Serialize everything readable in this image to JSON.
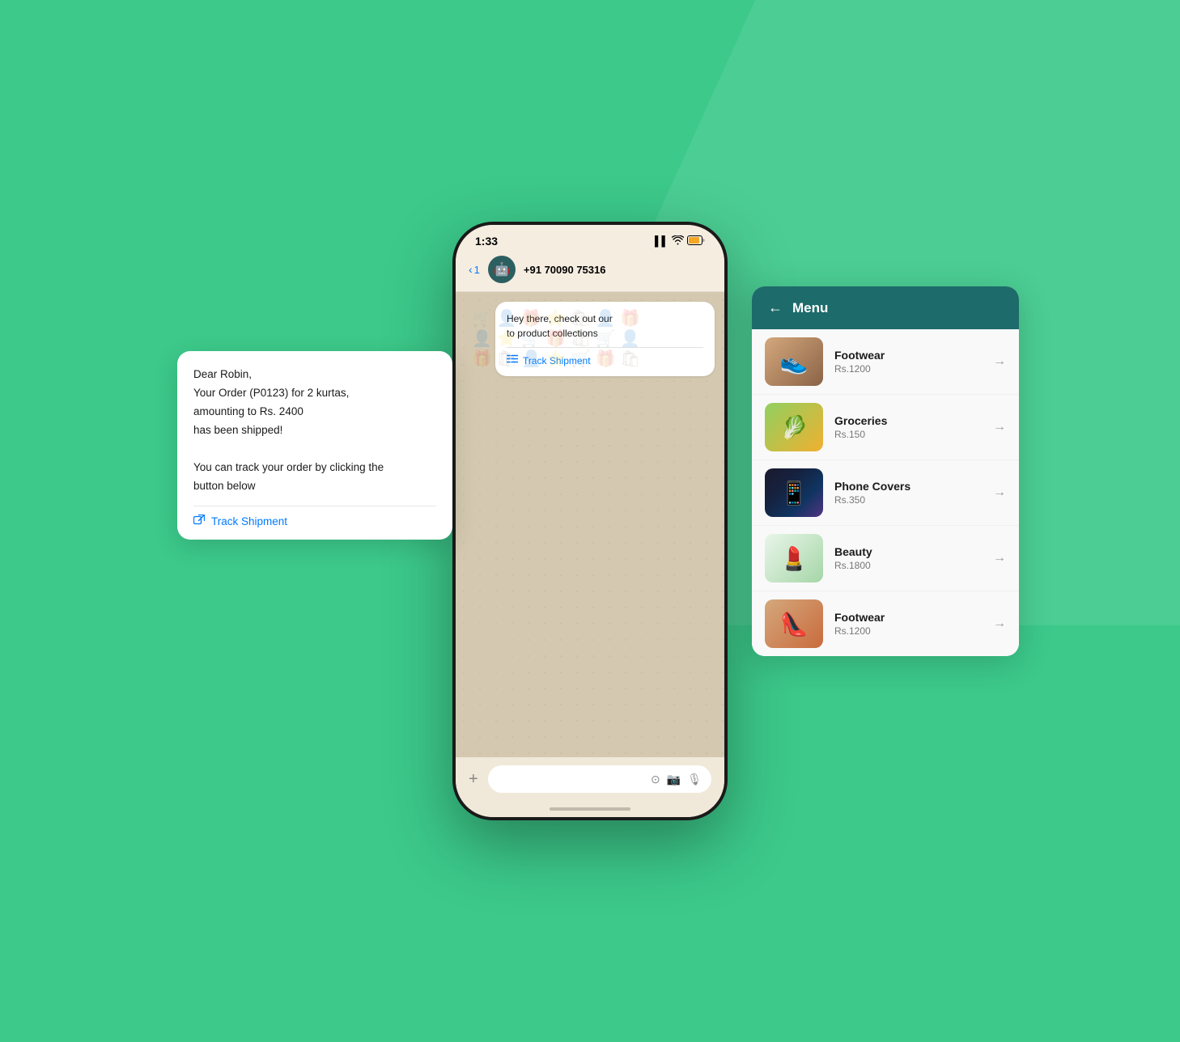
{
  "background": {
    "color": "#3cc98a"
  },
  "status_bar": {
    "time": "1:33",
    "signal": "▌▌",
    "wifi": "WiFi",
    "battery": "🔋"
  },
  "nav": {
    "back_label": "< 1",
    "contact_name": "+91 70090 75316"
  },
  "chat": {
    "bubble1": {
      "text": "Hey there, check out our\nto product collections",
      "link_label": "Track Shipment"
    }
  },
  "bottom_bar": {
    "plus": "+",
    "icons": [
      "⊙",
      "📷",
      "🎙"
    ]
  },
  "left_card": {
    "text": "Dear Robin,\nYour Order (P0123) for 2 kurtas,\namounting to Rs. 2400\nhas been shipped!\n\nYou can track your order by clicking the\nbutton below",
    "link_label": "Track Shipment"
  },
  "menu": {
    "title": "Menu",
    "back_icon": "←",
    "items": [
      {
        "name": "Footwear",
        "price": "Rs.1200",
        "emoji": "👟"
      },
      {
        "name": "Groceries",
        "price": "Rs.150",
        "emoji": "🥬"
      },
      {
        "name": "Phone Covers",
        "price": "Rs.350",
        "emoji": "📱"
      },
      {
        "name": "Beauty",
        "price": "Rs.1800",
        "emoji": "💄"
      },
      {
        "name": "Footwear",
        "price": "Rs.1200",
        "emoji": "👠"
      }
    ]
  }
}
